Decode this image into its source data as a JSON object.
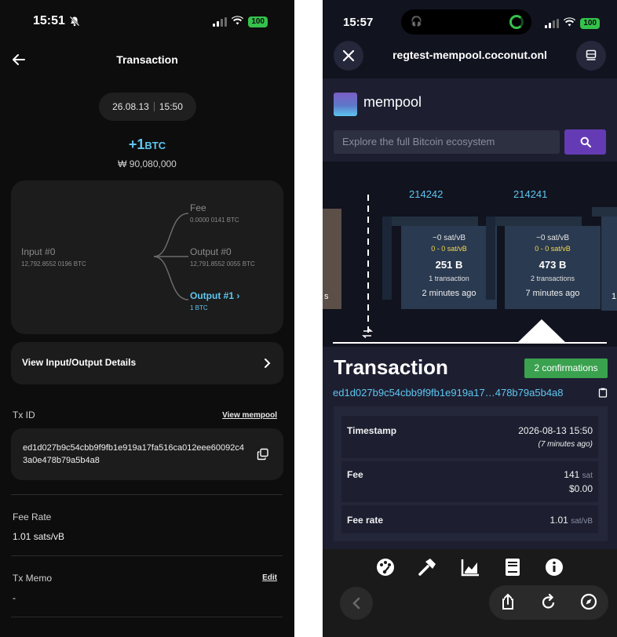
{
  "left": {
    "status": {
      "time": "15:51",
      "battery": "100"
    },
    "header": {
      "title": "Transaction"
    },
    "date": {
      "day": "26.08.13",
      "time": "15:50"
    },
    "amount": {
      "value": "+1",
      "unit": "BTC",
      "fiat": "₩ 90,080,000"
    },
    "flow": {
      "input": {
        "label": "Input #0",
        "value": "12,792.8552 0196 BTC"
      },
      "fee": {
        "label": "Fee",
        "value": "0.0000 0141 BTC"
      },
      "output0": {
        "label": "Output #0",
        "value": "12,791.8552 0055 BTC"
      },
      "output1": {
        "label": "Output #1",
        "value": "1 BTC"
      }
    },
    "io_details": "View Input/Output Details",
    "txid": {
      "label": "Tx ID",
      "link": "View mempool",
      "value": "ed1d027b9c54cbb9f9fb1e919a17fa516ca012eee60092c43a0e478b79a5b4a8"
    },
    "fee_rate": {
      "label": "Fee Rate",
      "value": "1.01 sats/vB"
    },
    "memo": {
      "label": "Tx Memo",
      "edit": "Edit",
      "value": "-"
    }
  },
  "right": {
    "status": {
      "time": "15:57",
      "battery": "100"
    },
    "url": "regtest-mempool.coconut.onl",
    "logo_text": "mempool",
    "search_placeholder": "Explore the full Bitcoin ecosystem",
    "blocks": [
      {
        "height": "214242",
        "fee_median": "~0 sat/vB",
        "fee_range": "0 - 0 sat/vB",
        "size": "251 B",
        "tx_count": "1 transaction",
        "age": "2 minutes ago"
      },
      {
        "height": "214241",
        "fee_median": "~0 sat/vB",
        "fee_range": "0 - 0 sat/vB",
        "size": "473 B",
        "tx_count": "2 transactions",
        "age": "7 minutes ago"
      }
    ],
    "edge_left_text": "s",
    "edge_right_text": "1",
    "tx_title": "Transaction",
    "confirmations": "2 confirmations",
    "txid_short": "ed1d027b9c54cbb9f9fb1e919a17…478b79a5b4a8",
    "details": {
      "timestamp": {
        "label": "Timestamp",
        "value": "2026-08-13 15:50",
        "ago": "(7 minutes ago)"
      },
      "fee": {
        "label": "Fee",
        "value": "141",
        "unit": "sat",
        "fiat": "$0.00"
      },
      "fee_rate": {
        "label": "Fee rate",
        "value": "1.01",
        "unit": "sat/vB"
      }
    },
    "colors": {
      "accent": "#5fc6f0",
      "confirm": "#3aa14f",
      "search_button": "#653bb5",
      "fee_range": "#f6d94e"
    }
  }
}
